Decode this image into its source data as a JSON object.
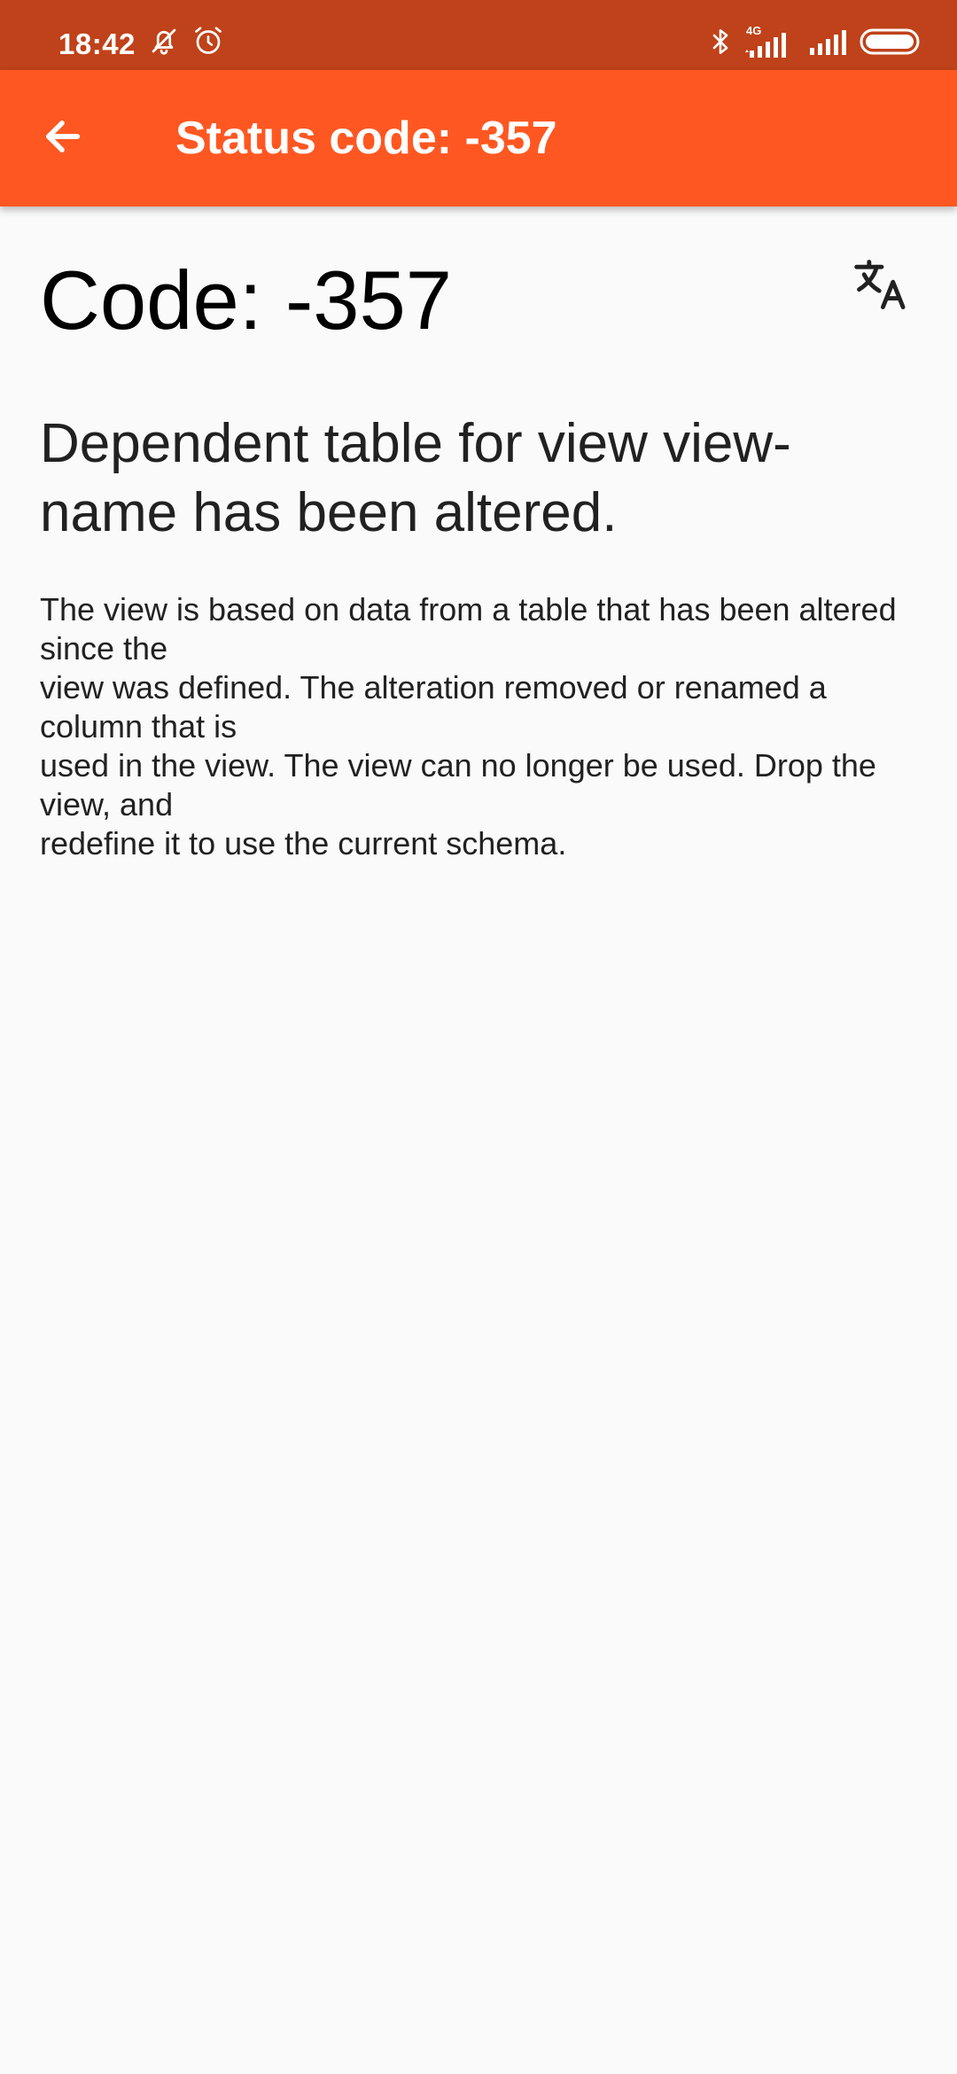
{
  "status_bar": {
    "time": "18:42",
    "network_label": "4G",
    "icons": [
      "muted-bell-icon",
      "alarm-icon",
      "bluetooth-icon",
      "signal-4g-icon",
      "signal-icon",
      "battery-icon"
    ]
  },
  "app_bar": {
    "title": "Status code: -357",
    "back_icon": "arrow-back-icon"
  },
  "content": {
    "code_heading": "Code: -357",
    "translate_icon": "translate-icon",
    "message_title": "Dependent table for view view-name has been altered.",
    "message_body_lines": [
      "The view is based on data from a table that has been altered since the",
      "view was defined. The alteration removed or renamed a column that is",
      "used in the view. The view can no longer be used. Drop the view, and",
      "redefine it to use the current schema."
    ]
  },
  "colors": {
    "status_bar": "#bf421a",
    "app_bar": "#ff5722",
    "background": "#fafafa",
    "text_primary": "#212121"
  }
}
